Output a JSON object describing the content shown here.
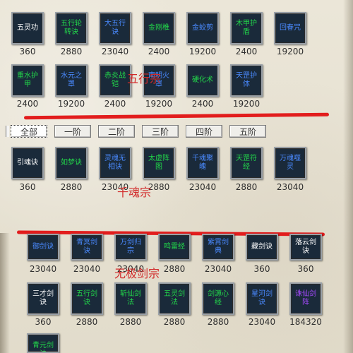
{
  "sections": {
    "wuxing": {
      "title": "五行宗",
      "row1": [
        {
          "name": "五灵功",
          "price": "360",
          "color": "white"
        },
        {
          "name": "五行轮转诀",
          "price": "2880",
          "color": "green"
        },
        {
          "name": "大五行诀",
          "price": "23040",
          "color": "blue"
        },
        {
          "name": "金刚椎",
          "price": "2400",
          "color": "green"
        },
        {
          "name": "金蛟剪",
          "price": "19200",
          "color": "blue"
        },
        {
          "name": "木甲护盾",
          "price": "2400",
          "color": "green"
        },
        {
          "name": "回春咒",
          "price": "19200",
          "color": "blue"
        }
      ],
      "row2": [
        {
          "name": "重水护甲",
          "price": "2400",
          "color": "green"
        },
        {
          "name": "水元之罩",
          "price": "19200",
          "color": "blue"
        },
        {
          "name": "赤炎战铠",
          "price": "2400",
          "color": "green"
        },
        {
          "name": "南明火罩",
          "price": "19200",
          "color": "blue"
        },
        {
          "name": "硬化术",
          "price": "2400",
          "color": "green"
        },
        {
          "name": "天罡护体",
          "price": "19200",
          "color": "blue"
        }
      ]
    },
    "qianhun": {
      "title": "千魂宗",
      "tabs": [
        "全部",
        "一阶",
        "二阶",
        "三阶",
        "四阶",
        "五阶"
      ],
      "row1": [
        {
          "name": "引魂诀",
          "price": "360",
          "color": "white"
        },
        {
          "name": "如梦诀",
          "price": "2880",
          "color": "green"
        },
        {
          "name": "灵魂无相诀",
          "price": "23040",
          "color": "blue"
        },
        {
          "name": "太虚阵图",
          "price": "2880",
          "color": "green"
        },
        {
          "name": "千魂聚魄",
          "price": "23040",
          "color": "blue"
        },
        {
          "name": "天罡符经",
          "price": "2880",
          "color": "green"
        },
        {
          "name": "万魂噬灵",
          "price": "23040",
          "color": "blue"
        }
      ]
    },
    "wuji": {
      "title": "无极剑宗",
      "row1": [
        {
          "name": "御剑诀",
          "price": "23040",
          "color": "blue"
        },
        {
          "name": "青冥剑诀",
          "price": "23040",
          "color": "blue"
        },
        {
          "name": "万剑归宗",
          "price": "23040",
          "color": "blue"
        },
        {
          "name": "鸣雷经",
          "price": "2880",
          "color": "green"
        },
        {
          "name": "紫霄剑典",
          "price": "23040",
          "color": "blue"
        },
        {
          "name": "藏剑诀",
          "price": "360",
          "color": "white"
        },
        {
          "name": "落云剑诀",
          "price": "360",
          "color": "white"
        }
      ],
      "row2": [
        {
          "name": "三才剑诀",
          "price": "360",
          "color": "white"
        },
        {
          "name": "五行剑诀",
          "price": "2880",
          "color": "green"
        },
        {
          "name": "斩仙剑法",
          "price": "2880",
          "color": "green"
        },
        {
          "name": "五灵剑法",
          "price": "2880",
          "color": "green"
        },
        {
          "name": "剑源心经",
          "price": "2880",
          "color": "green"
        },
        {
          "name": "星河剑诀",
          "price": "23040",
          "color": "blue"
        },
        {
          "name": "诛仙剑阵",
          "price": "184320",
          "color": "purple"
        }
      ],
      "row3": [
        {
          "name": "青元剑诀",
          "price": "",
          "color": "green"
        }
      ]
    }
  },
  "colors": {
    "white": "#ffffff",
    "green": "#22d84a",
    "blue": "#4a8aff",
    "purple": "#a64aff",
    "annotation": "#d22a2a"
  }
}
